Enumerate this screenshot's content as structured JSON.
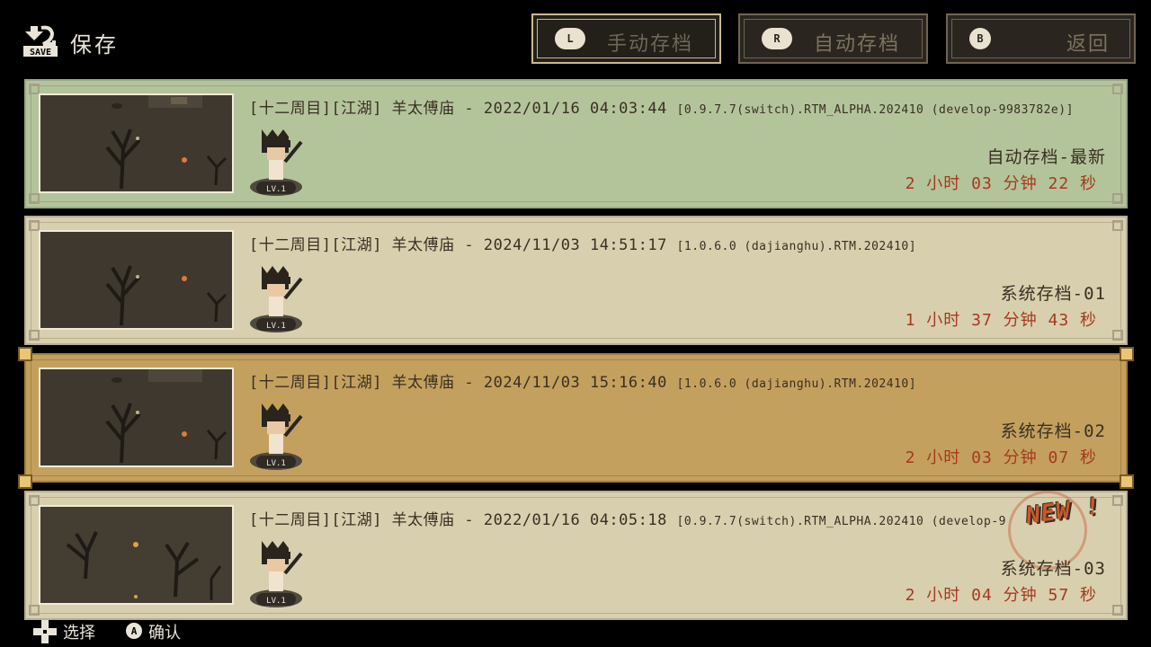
{
  "header": {
    "save_icon_text": "SAVE",
    "title": "保存",
    "tabs": [
      {
        "badge": "L",
        "label": "手动存档"
      },
      {
        "badge": "R",
        "label": "自动存档"
      },
      {
        "badge": "B",
        "label": "返回"
      }
    ]
  },
  "slots": [
    {
      "title": "[十二周目][江湖] 羊太傅庙 - 2022/01/16 04:03:44",
      "version": "[0.9.7.7(switch).RTM_ALPHA.202410 (develop-9983782e)]",
      "level": "LV.1",
      "name": "自动存档-最新",
      "playtime": "2 小时 03 分钟 22 秒",
      "state": "latest"
    },
    {
      "title": "[十二周目][江湖] 羊太傅庙 - 2024/11/03 14:51:17",
      "version": "[1.0.6.0 (dajianghu).RTM.202410]",
      "level": "LV.1",
      "name": "系统存档-01",
      "playtime": "1 小时 37 分钟 43 秒",
      "state": "normal"
    },
    {
      "title": "[十二周目][江湖] 羊太傅庙 - 2024/11/03 15:16:40",
      "version": "[1.0.6.0 (dajianghu).RTM.202410]",
      "level": "LV.1",
      "name": "系统存档-02",
      "playtime": "2 小时 03 分钟 07 秒",
      "state": "selected"
    },
    {
      "title": "[十二周目][江湖] 羊太傅庙 - 2022/01/16 04:05:18",
      "version": "[0.9.7.7(switch).RTM_ALPHA.202410 (develop-9",
      "level": "LV.1",
      "name": "系统存档-03",
      "playtime": "2 小时 04 分钟 57 秒",
      "state": "new",
      "badge": "NEW !"
    }
  ],
  "footer": {
    "select_label": "选择",
    "confirm_button": "A",
    "confirm_label": "确认"
  },
  "colors": {
    "latest_bg": "#b3c49a",
    "normal_bg": "#d8cfae",
    "selected_bg": "#c4a05e",
    "playtime_text": "#a33a20"
  }
}
